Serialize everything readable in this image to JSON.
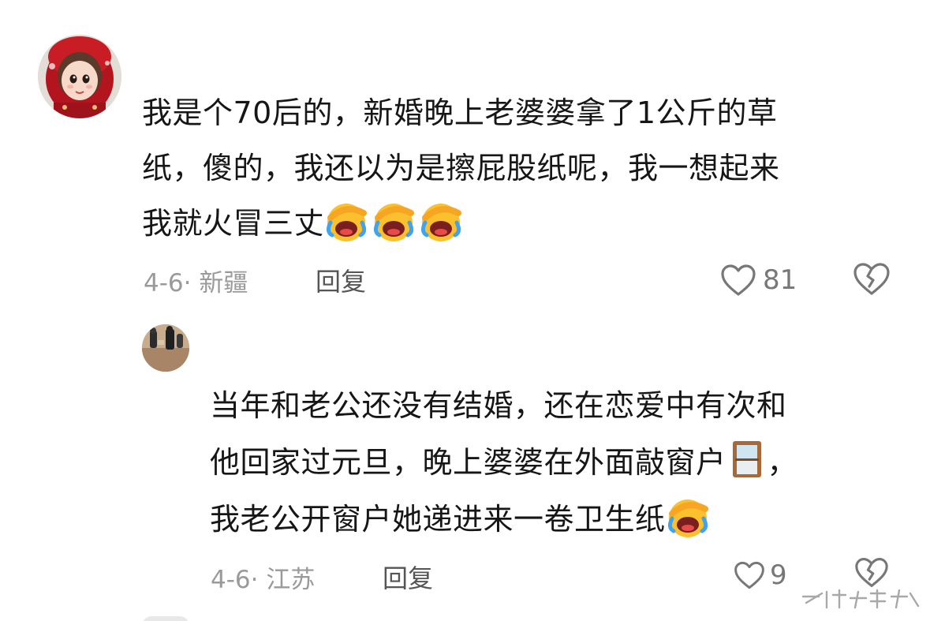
{
  "comments": [
    {
      "text_lines": [
        "我是个70后的，新婚晚上老婆婆拿了1公斤的草",
        "纸，傻的，我还以为是擦屁股纸呢，我一想起来",
        "我就火冒三丈"
      ],
      "emoji": "laughing-crying-emoji",
      "emoji_count": 3,
      "date_location": "4-6· 新疆",
      "reply_label": "回复",
      "likes": "81"
    },
    {
      "text_lines": [
        "当年和老公还没有结婚，还在恋爱中有次和",
        "他回家过元旦，晚上婆婆在外面敲窗户",
        "，",
        "我老公开窗户她递进来一卷卫生纸"
      ],
      "inline_emoji_1": "window-emoji",
      "inline_emoji_2": "laughing-crying-emoji",
      "date_location": "4-6· 江苏",
      "reply_label": "回复",
      "likes": "9"
    }
  ],
  "colors": {
    "text": "#161616",
    "meta": "#9a9a9a",
    "reply": "#555555",
    "icon": "#777777"
  }
}
